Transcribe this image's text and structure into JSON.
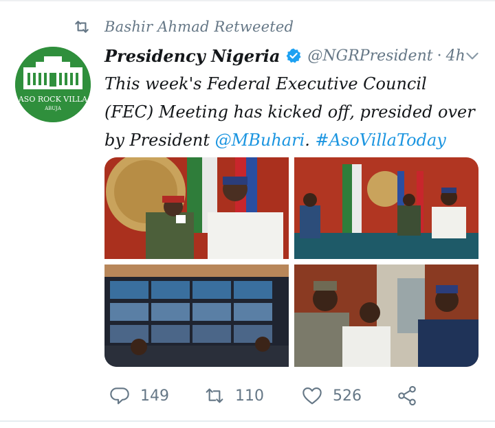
{
  "retweet_context": {
    "text": "Bashir Ahmad Retweeted",
    "icon": "retweet-icon"
  },
  "author": {
    "display_name": "Presidency Nigeria",
    "verified": true,
    "handle": "@NGRPresident",
    "separator": "·",
    "time": "4h",
    "avatar": {
      "title": "ASO ROCK VILLA",
      "subtitle": "ABUJA",
      "color": "#2f8f3c"
    }
  },
  "tweet": {
    "text_before": "This week's Federal Executive Council (FEC) Meeting has kicked off, presided over by President ",
    "mention": "@MBuhari",
    "text_middle": ". ",
    "hashtag": "#AsoVillaToday"
  },
  "media": {
    "photos": [
      {
        "name": "president-with-aide-salute"
      },
      {
        "name": "fec-chamber-wide"
      },
      {
        "name": "virtual-meeting-screens"
      },
      {
        "name": "ministers-conversation"
      }
    ]
  },
  "actions": {
    "replies": "149",
    "retweets": "110",
    "likes": "526",
    "icons": [
      "reply-icon",
      "retweet-icon",
      "heart-icon",
      "share-icon"
    ]
  },
  "colors": {
    "link": "#1b95e0",
    "muted": "#657786",
    "verified": "#1da1f2"
  }
}
